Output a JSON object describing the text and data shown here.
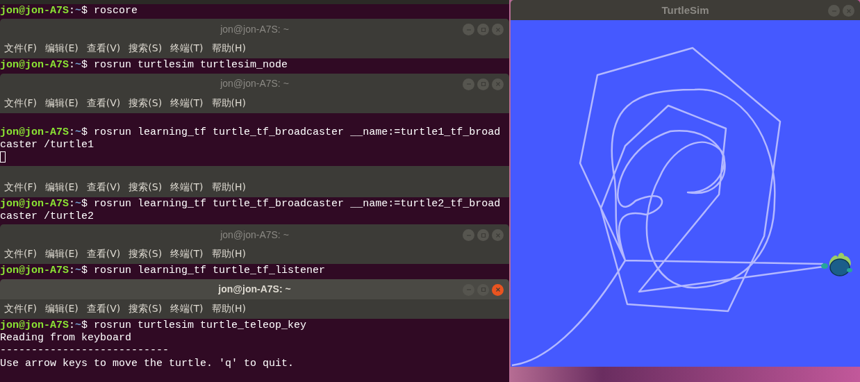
{
  "terminals": [
    {
      "lines": [
        {
          "kind": "prompt",
          "user": "jon@jon-A7S",
          "sep": ":",
          "path": "~",
          "command": "$ roscore"
        }
      ]
    },
    {
      "title": "jon@jon-A7S: ~",
      "active": false,
      "menu": [
        "文件(F)",
        "编辑(E)",
        "查看(V)",
        "搜索(S)",
        "终端(T)",
        "帮助(H)"
      ],
      "lines": [
        {
          "kind": "prompt",
          "user": "jon@jon-A7S",
          "sep": ":",
          "path": "~",
          "command": "$ rosrun turtlesim turtlesim_node"
        }
      ]
    },
    {
      "title": "jon@jon-A7S: ~",
      "active": false,
      "menu": [
        "文件(F)",
        "编辑(E)",
        "查看(V)",
        "搜索(S)",
        "终端(T)",
        "帮助(H)"
      ],
      "lines": [
        {
          "kind": "blank"
        },
        {
          "kind": "prompt",
          "user": "jon@jon-A7S",
          "sep": ":",
          "path": "~",
          "command": "$ rosrun learning_tf turtle_tf_broadcaster __name:=turtle1_tf_broad"
        },
        {
          "kind": "output",
          "text": "caster /turtle1"
        },
        {
          "kind": "cursor"
        }
      ]
    },
    {
      "menu": [
        "文件(F)",
        "编辑(E)",
        "查看(V)",
        "搜索(S)",
        "终端(T)",
        "帮助(H)"
      ],
      "lines": [
        {
          "kind": "prompt",
          "user": "jon@jon-A7S",
          "sep": ":",
          "path": "~",
          "command": "$ rosrun learning_tf turtle_tf_broadcaster __name:=turtle2_tf_broad"
        },
        {
          "kind": "output",
          "text": "caster /turtle2"
        }
      ]
    },
    {
      "title": "jon@jon-A7S: ~",
      "active": false,
      "menu": [
        "文件(F)",
        "编辑(E)",
        "查看(V)",
        "搜索(S)",
        "终端(T)",
        "帮助(H)"
      ],
      "lines": [
        {
          "kind": "prompt",
          "user": "jon@jon-A7S",
          "sep": ":",
          "path": "~",
          "command": "$ rosrun learning_tf turtle_tf_listener"
        }
      ]
    },
    {
      "title": "jon@jon-A7S: ~",
      "active": true,
      "menu": [
        "文件(F)",
        "编辑(E)",
        "查看(V)",
        "搜索(S)",
        "终端(T)",
        "帮助(H)"
      ],
      "lines": [
        {
          "kind": "prompt",
          "user": "jon@jon-A7S",
          "sep": ":",
          "path": "~",
          "command": "$ rosrun turtlesim turtle_teleop_key"
        },
        {
          "kind": "output",
          "text": "Reading from keyboard"
        },
        {
          "kind": "output",
          "text": "---------------------------"
        },
        {
          "kind": "output",
          "text": "Use arrow keys to move the turtle. 'q' to quit."
        }
      ]
    }
  ],
  "turtlesim": {
    "title": "TurtleSim",
    "active": false
  }
}
